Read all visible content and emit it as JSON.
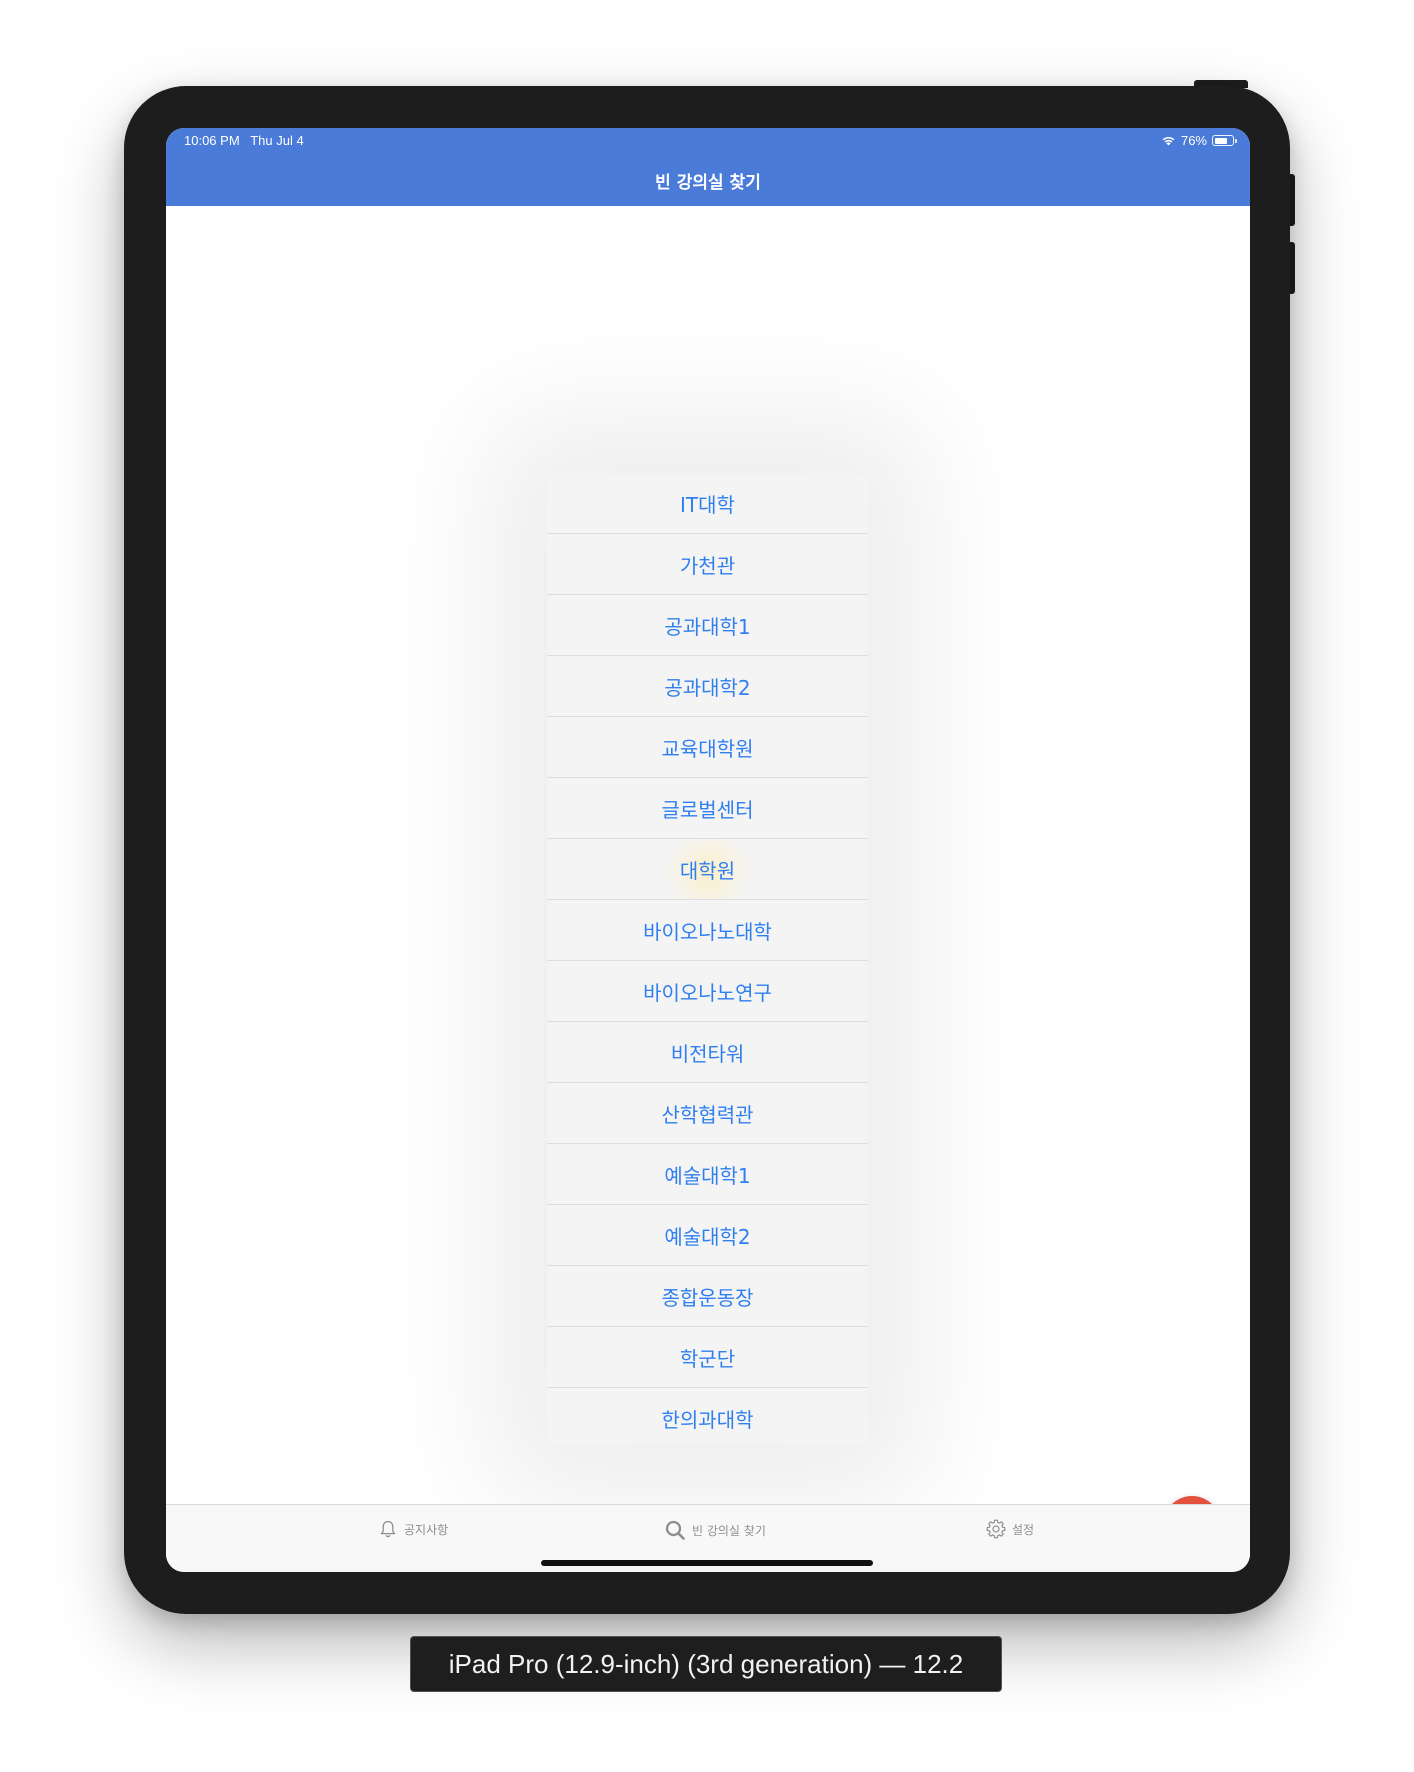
{
  "status_bar": {
    "time_date": "10:06 PM   Thu Jul 4",
    "battery_percent": "76%",
    "battery_level": 0.76,
    "wifi_icon": "wifi-icon",
    "battery_icon": "battery-icon"
  },
  "nav": {
    "title": "빈 강의실 찾기"
  },
  "building_list": {
    "items": [
      "IT대학",
      "가천관",
      "공과대학1",
      "공과대학2",
      "교육대학원",
      "글로벌센터",
      "대학원",
      "바이오나노대학",
      "바이오나노연구",
      "비전타워",
      "산학협력관",
      "예술대학1",
      "예술대학2",
      "종합운동장",
      "학군단",
      "한의과대학"
    ]
  },
  "fab": {
    "icon": "search-icon",
    "color": "#e3503e"
  },
  "tab_bar": {
    "tabs": [
      {
        "label": "공지사항",
        "icon": "bell-icon"
      },
      {
        "label": "빈 강의실 찾기",
        "icon": "search-icon"
      },
      {
        "label": "설정",
        "icon": "gear-icon"
      }
    ]
  },
  "device_caption": "iPad Pro (12.9-inch) (3rd generation) — 12.2",
  "colors": {
    "nav_bar": "#4a7bd8",
    "list_text": "#2f7ff0",
    "tab_inactive": "#8e8e8e"
  }
}
